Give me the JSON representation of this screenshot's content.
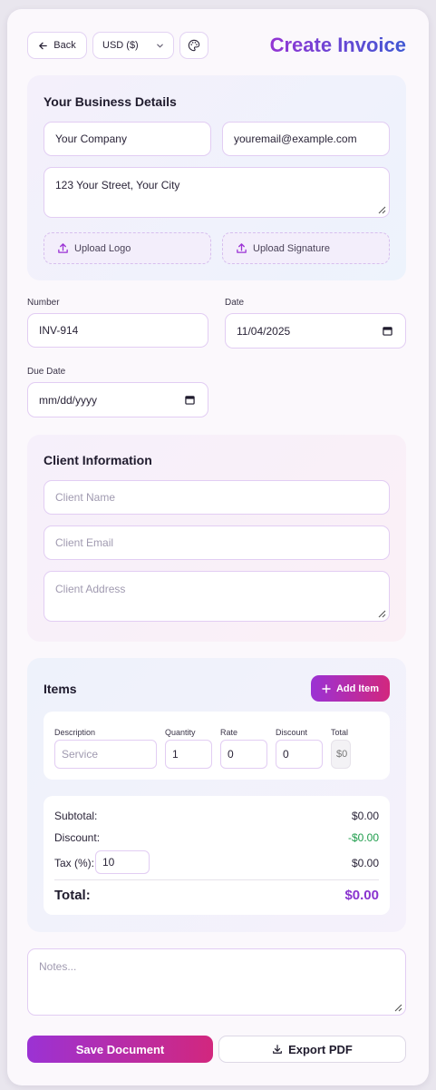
{
  "header": {
    "back_label": "Back",
    "currency": "USD ($)",
    "title": "Create Invoice",
    "icons": {
      "back": "arrow-left-icon",
      "dropdown": "chevron-down-icon",
      "theme": "palette-icon"
    }
  },
  "business": {
    "section_title": "Your Business Details",
    "company": "Your Company",
    "email": "youremail@example.com",
    "address": "123 Your Street, Your City",
    "upload_logo": "Upload Logo",
    "upload_signature": "Upload Signature"
  },
  "meta": {
    "number_label": "Number",
    "number": "INV-914",
    "date_label": "Date",
    "date": "11/04/2025",
    "due_label": "Due Date",
    "due_placeholder": "mm/dd/yyyy"
  },
  "client": {
    "section_title": "Client Information",
    "name_placeholder": "Client Name",
    "email_placeholder": "Client Email",
    "address_placeholder": "Client Address"
  },
  "items": {
    "section_title": "Items",
    "add_label": "Add Item",
    "columns": [
      "Description",
      "Quantity",
      "Rate",
      "Discount",
      "Total"
    ],
    "rows": [
      {
        "description_placeholder": "Service",
        "quantity": "1",
        "rate": "0",
        "discount": "0",
        "total": "$0"
      }
    ]
  },
  "summary": {
    "subtotal_label": "Subtotal:",
    "subtotal": "$0.00",
    "discount_label": "Discount:",
    "discount": "-$0.00",
    "tax_label": "Tax (%):",
    "tax_value": "10",
    "tax_amount": "$0.00",
    "total_label": "Total:",
    "total": "$0.00"
  },
  "notes_placeholder": "Notes...",
  "actions": {
    "save_label": "Save Document",
    "export_label": "Export PDF"
  },
  "colors": {
    "accent_purple": "#9b32d4",
    "accent_pink": "#d2277e",
    "accent_blue": "#3f58d3",
    "discount_green": "#1f9d4c",
    "border": "#e2cdf3"
  }
}
